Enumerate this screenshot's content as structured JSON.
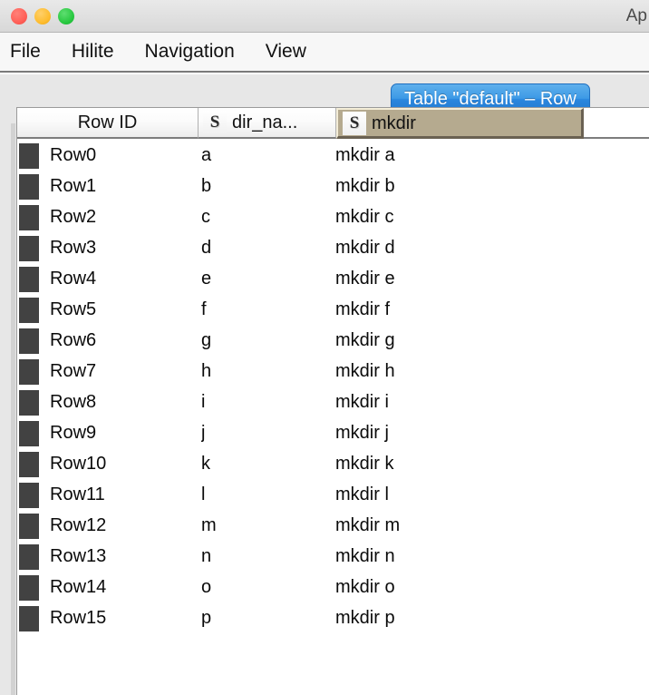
{
  "window": {
    "title": "Ap",
    "controls": {
      "close_label": "close",
      "minimize_label": "minimize",
      "maximize_label": "maximize"
    },
    "colors": {
      "close": "#ff5f57",
      "minimize": "#febc2e",
      "maximize": "#28c840",
      "selected_header": "#b5aa8f",
      "tab_blue": "#2a87de",
      "row_swatch": "#424242"
    }
  },
  "menubar": {
    "items": [
      {
        "label": "File"
      },
      {
        "label": "Hilite"
      },
      {
        "label": "Navigation"
      },
      {
        "label": "View"
      }
    ]
  },
  "tab": {
    "label": "Table \"default\" – Row"
  },
  "table": {
    "columns": [
      {
        "id": "rowid",
        "label": "Row ID",
        "type_icon": "",
        "selected": false
      },
      {
        "id": "dirname",
        "label": "dir_na...",
        "type_icon": "S",
        "selected": false
      },
      {
        "id": "mkdir",
        "label": "mkdir",
        "type_icon": "S",
        "selected": true
      }
    ],
    "rows": [
      {
        "rowid": "Row0",
        "dirname": "a",
        "mkdir": "mkdir a"
      },
      {
        "rowid": "Row1",
        "dirname": "b",
        "mkdir": "mkdir b"
      },
      {
        "rowid": "Row2",
        "dirname": "c",
        "mkdir": "mkdir c"
      },
      {
        "rowid": "Row3",
        "dirname": "d",
        "mkdir": "mkdir d"
      },
      {
        "rowid": "Row4",
        "dirname": "e",
        "mkdir": "mkdir e"
      },
      {
        "rowid": "Row5",
        "dirname": "f",
        "mkdir": "mkdir f"
      },
      {
        "rowid": "Row6",
        "dirname": "g",
        "mkdir": "mkdir g"
      },
      {
        "rowid": "Row7",
        "dirname": "h",
        "mkdir": "mkdir h"
      },
      {
        "rowid": "Row8",
        "dirname": "i",
        "mkdir": "mkdir i"
      },
      {
        "rowid": "Row9",
        "dirname": "j",
        "mkdir": "mkdir j"
      },
      {
        "rowid": "Row10",
        "dirname": "k",
        "mkdir": "mkdir k"
      },
      {
        "rowid": "Row11",
        "dirname": "l",
        "mkdir": "mkdir l"
      },
      {
        "rowid": "Row12",
        "dirname": "m",
        "mkdir": "mkdir m"
      },
      {
        "rowid": "Row13",
        "dirname": "n",
        "mkdir": "mkdir n"
      },
      {
        "rowid": "Row14",
        "dirname": "o",
        "mkdir": "mkdir o"
      },
      {
        "rowid": "Row15",
        "dirname": "p",
        "mkdir": "mkdir p"
      }
    ]
  }
}
